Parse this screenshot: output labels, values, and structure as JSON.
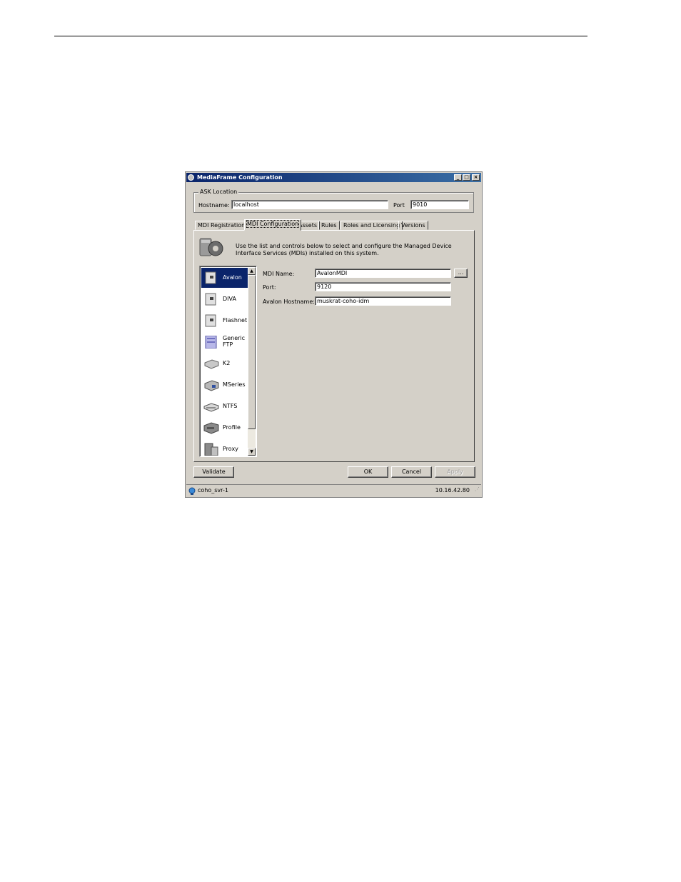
{
  "window": {
    "title": "MediaFrame Configuration",
    "controls": {
      "minimize": "_",
      "maximize": "□",
      "close": "×"
    }
  },
  "ask_location": {
    "legend": "ASK Location",
    "hostname_label": "Hostname:",
    "hostname_value": "localhost",
    "port_label": "Port",
    "port_value": "9010"
  },
  "tabs": [
    {
      "label": "MDI Registration",
      "active": false
    },
    {
      "label": "MDI Configuration",
      "active": true
    },
    {
      "label": "Assets",
      "active": false
    },
    {
      "label": "Rules",
      "active": false
    },
    {
      "label": "Roles and Licensing",
      "active": false
    },
    {
      "label": "Versions",
      "active": false
    }
  ],
  "mdi_panel": {
    "description": "Use the list and controls below to select and configure the Managed Device Interface Services (MDIs) installed on this system.",
    "devices": [
      {
        "name": "Avalon",
        "icon": "storage-server-icon",
        "selected": true
      },
      {
        "name": "DIVA",
        "icon": "storage-server-icon",
        "selected": false
      },
      {
        "name": "Flashnet",
        "icon": "storage-server-icon",
        "selected": false
      },
      {
        "name": "Generic FTP",
        "icon": "ftp-server-icon",
        "selected": false
      },
      {
        "name": "K2",
        "icon": "k2-device-icon",
        "selected": false
      },
      {
        "name": "MSeries",
        "icon": "mseries-device-icon",
        "selected": false
      },
      {
        "name": "NTFS",
        "icon": "ntfs-drive-icon",
        "selected": false
      },
      {
        "name": "Profile",
        "icon": "profile-device-icon",
        "selected": false
      },
      {
        "name": "Proxy",
        "icon": "proxy-server-icon",
        "selected": false
      }
    ],
    "mdi_name_label": "MDI Name:",
    "mdi_name_value": "AvalonMDI",
    "browse_label": "...",
    "port_label": "Port:",
    "port_value": "9120",
    "hostname_label": "Avalon Hostname:",
    "hostname_value": "muskrat-coho-idm"
  },
  "buttons": {
    "validate": "Validate",
    "ok": "OK",
    "cancel": "Cancel",
    "apply": "Apply"
  },
  "status": {
    "server": "coho_svr-1",
    "ip": "10.16.42.80"
  },
  "colors": {
    "titlebar": "#0a246a",
    "window_bg": "#d4d0c8",
    "selection": "#0a246a"
  }
}
